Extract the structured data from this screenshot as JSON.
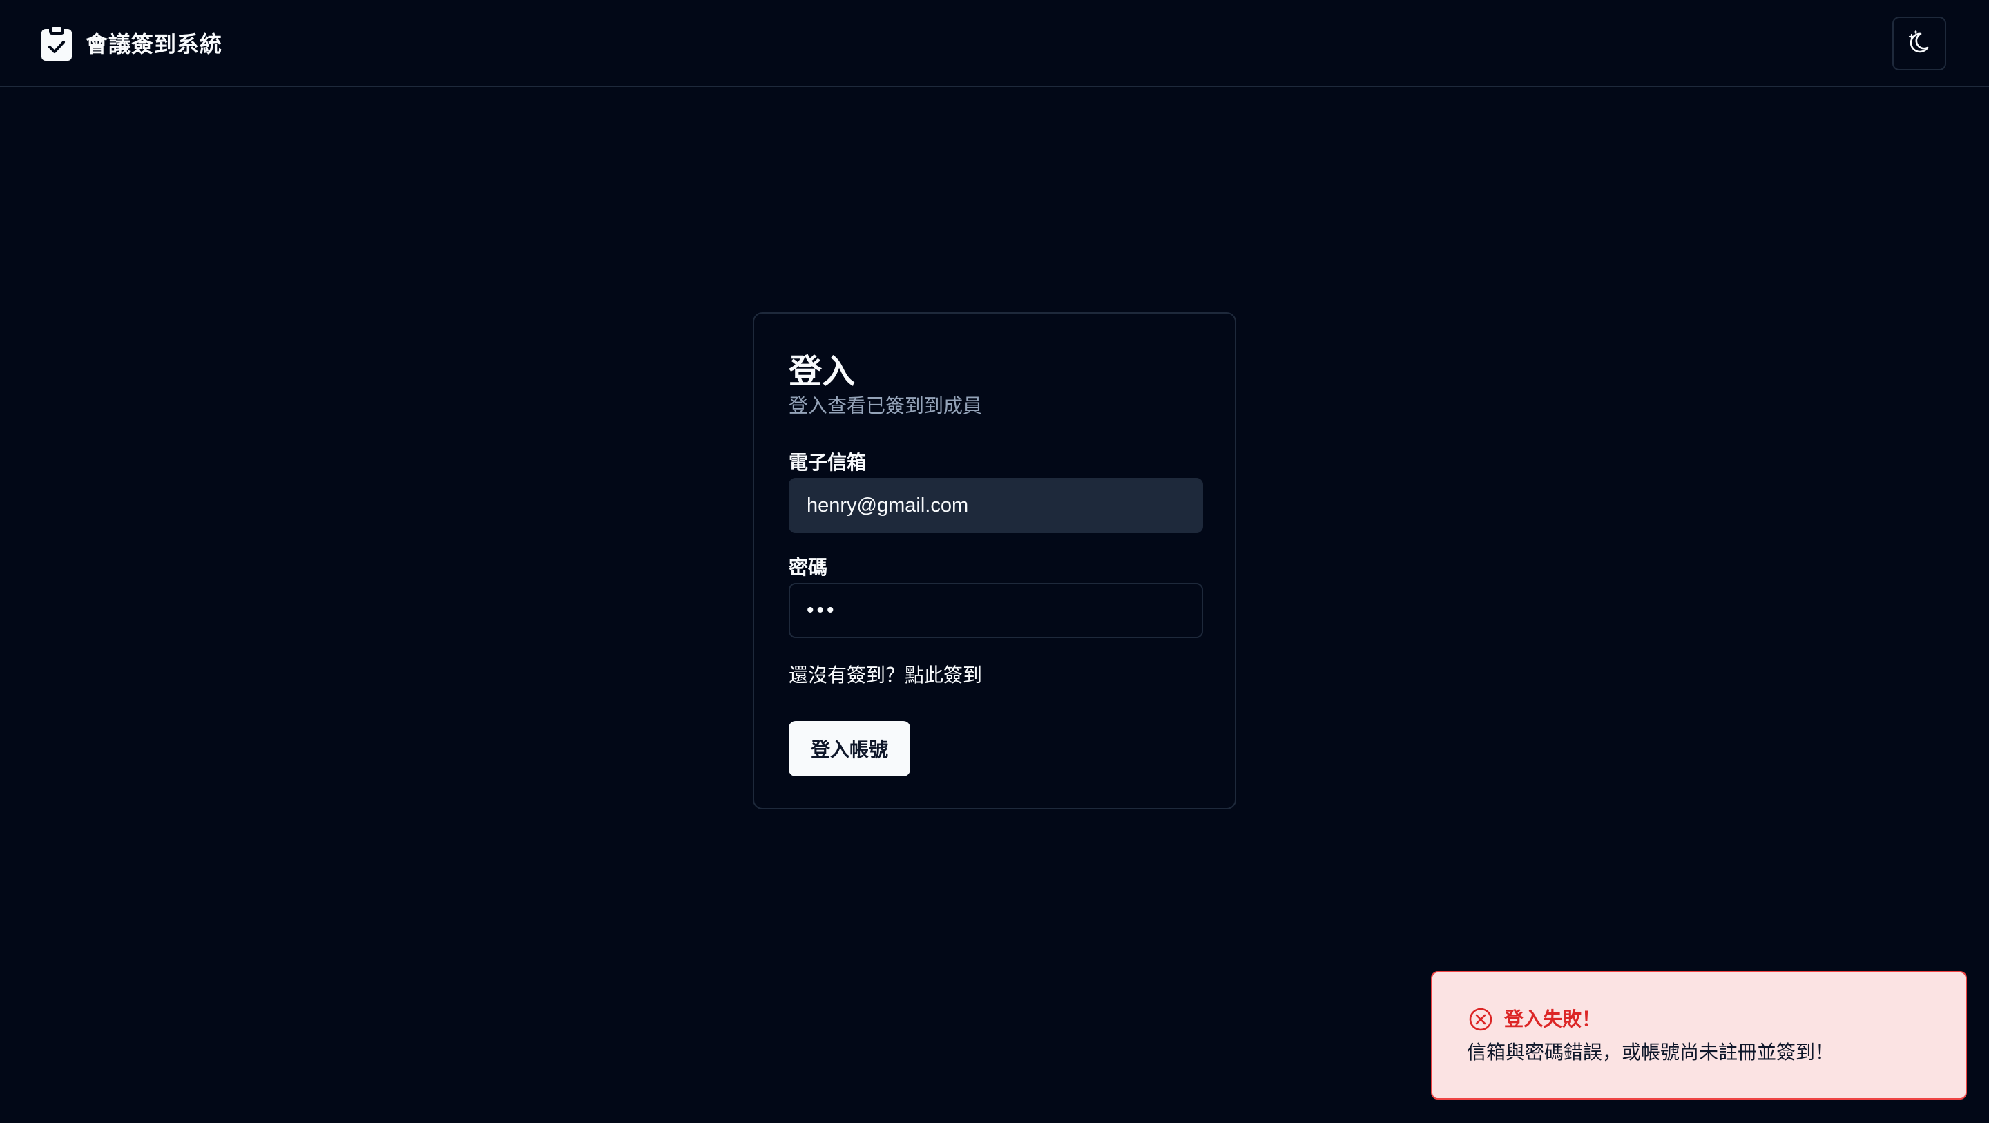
{
  "header": {
    "app_title": "會議簽到系統",
    "logo_icon": "clipboard-check-icon",
    "theme_toggle_icon": "moon-stars-icon"
  },
  "login_card": {
    "title": "登入",
    "subtitle": "登入查看已簽到到成員",
    "email_label": "電子信箱",
    "email_value": "henry@gmail.com",
    "password_label": "密碼",
    "password_value": "•••",
    "signup_link": "還沒有簽到？點此簽到",
    "submit_label": "登入帳號"
  },
  "toast": {
    "icon": "x-circle-icon",
    "title": "登入失敗！",
    "message": "信箱與密碼錯誤，或帳號尚未註冊並簽到！",
    "accent_color": "#dc2626",
    "background_color": "#fbe3e3"
  },
  "colors": {
    "background": "#020817",
    "border": "#1e293b",
    "text": "#f8fafc",
    "muted_text": "#94a3b8"
  }
}
